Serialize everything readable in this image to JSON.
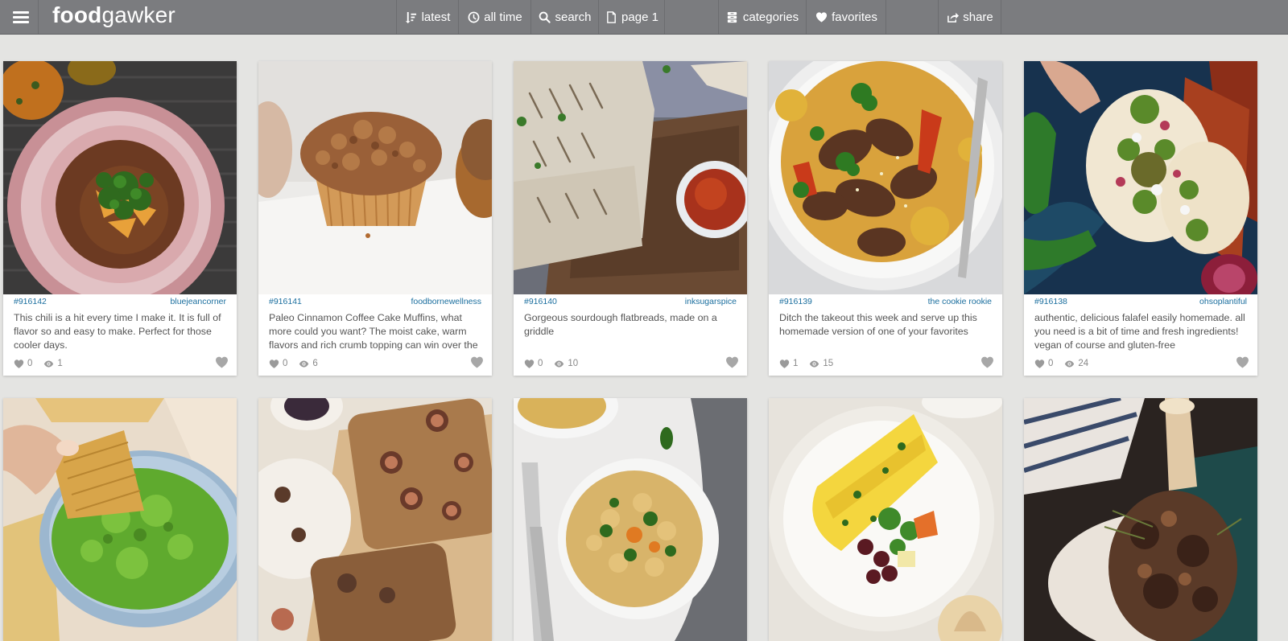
{
  "brand": {
    "logo_bold": "food",
    "logo_light": "gawker"
  },
  "nav": {
    "latest": "latest",
    "alltime": "all time",
    "search": "search",
    "page": "page 1",
    "categories": "categories",
    "favorites": "favorites",
    "share": "share"
  },
  "colors": {
    "topbar": "#7b7c7f",
    "link": "#1a6e9e",
    "background": "#e4e4e2"
  },
  "cards": [
    {
      "id": "#916142",
      "author": "bluejeancorner",
      "desc": "This chili is a hit every time I make it. It is full of flavor so and easy to make. Perfect for those cooler days.",
      "favs": "0",
      "views": "1",
      "photo": "chili in floral bowl"
    },
    {
      "id": "#916141",
      "author": "foodbornewellness",
      "desc": "Paleo Cinnamon Coffee Cake Muffins, what more could you want? The moist cake, warm flavors and rich crumb topping can win over the",
      "favs": "0",
      "views": "6",
      "photo": "crumb muffin"
    },
    {
      "id": "#916140",
      "author": "inksugarspice",
      "desc": "Gorgeous sourdough flatbreads, made on a griddle",
      "favs": "0",
      "views": "10",
      "photo": "flatbreads with sauce"
    },
    {
      "id": "#916139",
      "author": "the cookie rookie",
      "desc": "Ditch the takeout this week and serve up this homemade version of one of your favorites",
      "favs": "1",
      "views": "15",
      "photo": "beef noodle stir fry"
    },
    {
      "id": "#916138",
      "author": "ohsoplantiful",
      "desc": "authentic, delicious falafel easily homemade. all you need is a bit of time and fresh ingredients! vegan of course and gluten-free",
      "favs": "0",
      "views": "24",
      "photo": "falafel tacos"
    },
    {
      "photo": "guacamole with chips"
    },
    {
      "photo": "fig bread loaf"
    },
    {
      "photo": "pasta with herbs"
    },
    {
      "photo": "omelette on plate"
    },
    {
      "photo": "roasted meat shank"
    }
  ]
}
